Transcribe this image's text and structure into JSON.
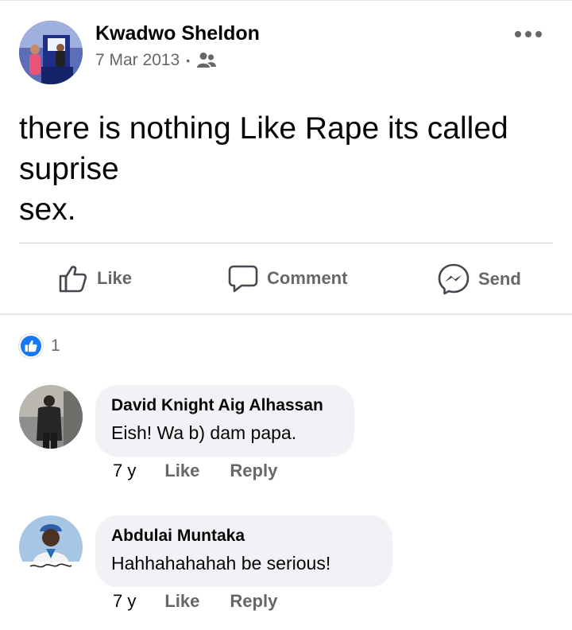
{
  "post": {
    "author": "Kwadwo Sheldon",
    "date": "7 Mar 2013",
    "separator": "•",
    "audience_icon": "friends-icon",
    "more_icon": "more-options-icon",
    "text": "there is nothing Like Rape its called\nsuprise\nsex."
  },
  "actions": {
    "like_label": "Like",
    "comment_label": "Comment",
    "send_label": "Send"
  },
  "reactions": {
    "icon": "like-reaction-icon",
    "count": "1"
  },
  "comments": [
    {
      "author": "David Knight Aig Alhassan",
      "text": "Eish! Wa b) dam papa.",
      "time": "7 y",
      "like_label": "Like",
      "reply_label": "Reply"
    },
    {
      "author": "Abdulai Muntaka",
      "text": "Hahhahahahah be serious!",
      "time": "7 y",
      "like_label": "Like",
      "reply_label": "Reply"
    }
  ],
  "colors": {
    "accent": "#1877f2",
    "secondary_text": "#65676b",
    "bubble_bg": "#f0f2f5"
  }
}
